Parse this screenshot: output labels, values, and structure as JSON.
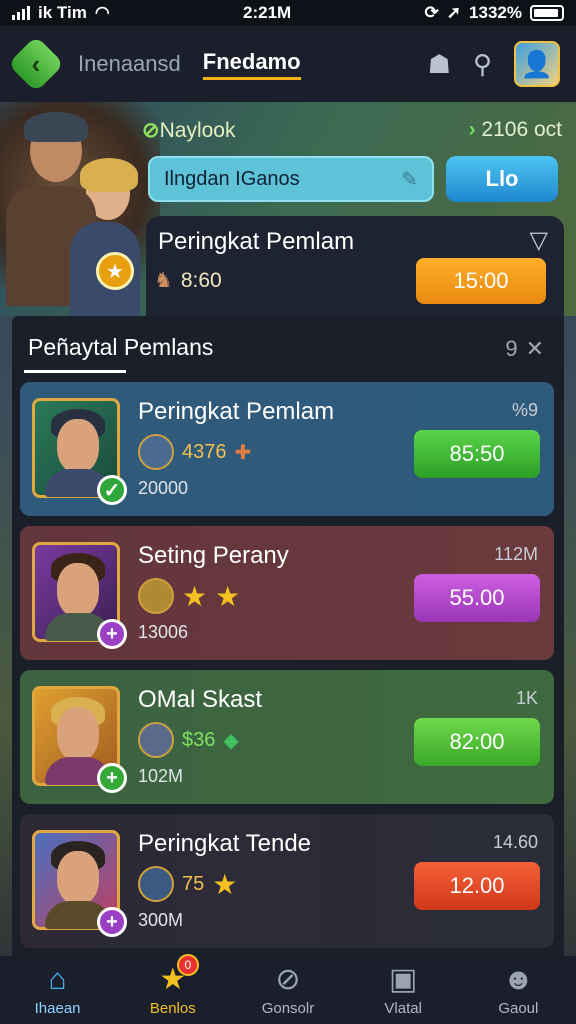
{
  "status_bar": {
    "carrier": "ik Tim",
    "time": "2:21M",
    "battery": "1332%"
  },
  "header": {
    "tabs": [
      {
        "label": "Inenaansd"
      },
      {
        "label": "Fnedamo"
      }
    ]
  },
  "hero": {
    "left_label": "Naylook",
    "right_label": "2106 oct",
    "search_value": "Ilngdan IGanos",
    "button_label": "Llo",
    "card_title": "Peringkat Pemlam",
    "card_stat": "8:60",
    "card_button": "15:00"
  },
  "panel": {
    "title": "Peñaytal Pemlans",
    "count": "9",
    "cards": [
      {
        "title": "Peringkat Pemlam",
        "meta": "%9",
        "stat": "4376",
        "sub": "20000",
        "button": "85:50",
        "button_color": "#39b72f",
        "badge_color": "#2fa63a",
        "badge_icon": "leaf-icon"
      },
      {
        "title": "Seting Perany",
        "meta": "112M",
        "stat": "",
        "sub": "13006",
        "button": "55.00",
        "button_color": "#b247c8",
        "badge_color": "#9b3fc4",
        "badge_icon": "plus-icon"
      },
      {
        "title": "OMal Skast",
        "meta": "1K",
        "stat": "$36",
        "sub": "102M",
        "button": "82:00",
        "button_color": "#4cbc30",
        "badge_color": "#36a838",
        "badge_icon": "plus-icon"
      },
      {
        "title": "Peringkat Tende",
        "meta": "14.60",
        "stat": "75",
        "sub": "300M",
        "button": "12.00",
        "button_color": "#e84a24",
        "badge_color": "#9b3fc4",
        "badge_icon": "plus-icon"
      }
    ]
  },
  "bottom_nav": {
    "items": [
      {
        "label": "Ihaean",
        "icon": "home-icon"
      },
      {
        "label": "Benlos",
        "icon": "star-icon",
        "badge": "0"
      },
      {
        "label": "Gonsolr",
        "icon": "compass-icon"
      },
      {
        "label": "Vlatal",
        "icon": "board-icon"
      },
      {
        "label": "Gaoul",
        "icon": "user-icon"
      }
    ]
  }
}
